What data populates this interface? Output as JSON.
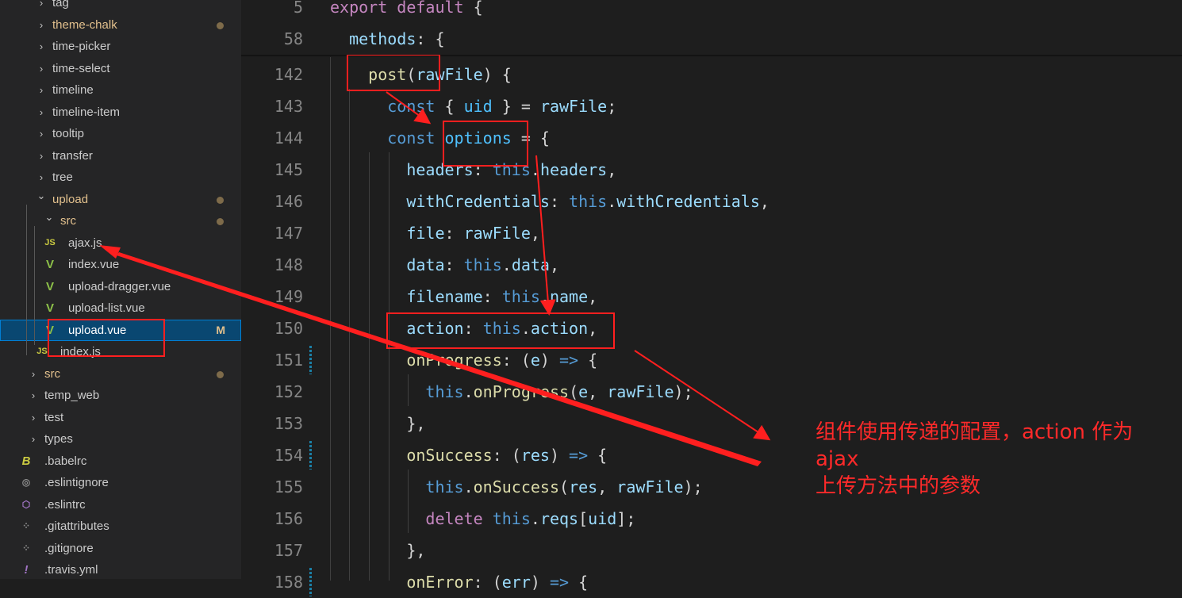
{
  "sidebar": {
    "rows": [
      {
        "label": "tag",
        "kind": "folder",
        "depth": 1
      },
      {
        "label": "theme-chalk",
        "kind": "folder",
        "depth": 1,
        "modified": true
      },
      {
        "label": "time-picker",
        "kind": "folder",
        "depth": 1
      },
      {
        "label": "time-select",
        "kind": "folder",
        "depth": 1
      },
      {
        "label": "timeline",
        "kind": "folder",
        "depth": 1
      },
      {
        "label": "timeline-item",
        "kind": "folder",
        "depth": 1
      },
      {
        "label": "tooltip",
        "kind": "folder",
        "depth": 1
      },
      {
        "label": "transfer",
        "kind": "folder",
        "depth": 1
      },
      {
        "label": "tree",
        "kind": "folder",
        "depth": 1
      },
      {
        "label": "upload",
        "kind": "folder-open",
        "depth": 1,
        "modified": true
      },
      {
        "label": "src",
        "kind": "folder-open",
        "depth": 2,
        "modified": true
      },
      {
        "label": "ajax.js",
        "kind": "js",
        "depth": 3
      },
      {
        "label": "index.vue",
        "kind": "vue",
        "depth": 3
      },
      {
        "label": "upload-dragger.vue",
        "kind": "vue",
        "depth": 3
      },
      {
        "label": "upload-list.vue",
        "kind": "vue",
        "depth": 3
      },
      {
        "label": "upload.vue",
        "kind": "vue",
        "depth": 3,
        "selected": true,
        "badge": "M"
      },
      {
        "label": "index.js",
        "kind": "js",
        "depth": 2
      },
      {
        "label": "src",
        "kind": "folder",
        "depth": 0,
        "modified": true
      },
      {
        "label": "temp_web",
        "kind": "folder",
        "depth": 0
      },
      {
        "label": "test",
        "kind": "folder",
        "depth": 0
      },
      {
        "label": "types",
        "kind": "folder",
        "depth": 0
      },
      {
        "label": ".babelrc",
        "kind": "babel",
        "depth": 0
      },
      {
        "label": ".eslintignore",
        "kind": "circle",
        "depth": 0
      },
      {
        "label": ".eslintrc",
        "kind": "eslint",
        "depth": 0
      },
      {
        "label": ".gitattributes",
        "kind": "git",
        "depth": 0
      },
      {
        "label": ".gitignore",
        "kind": "git",
        "depth": 0
      },
      {
        "label": ".travis.yml",
        "kind": "yml",
        "depth": 0
      }
    ],
    "icons": {
      "chevron_right": "›",
      "chevron_down": "⌄",
      "js": "JS",
      "vue": "V",
      "babel": "B",
      "circle": "◎",
      "eslint": "⬡",
      "git": "⁘",
      "yml": "!"
    }
  },
  "editor": {
    "lines": [
      {
        "num": "5",
        "sticky": true,
        "tokens": [
          [
            "kw2",
            "export "
          ],
          [
            "kw2",
            "default "
          ],
          [
            "pn",
            "{"
          ]
        ]
      },
      {
        "num": "58",
        "sticky": true,
        "tokens": [
          [
            "pn",
            "  "
          ],
          [
            "pr",
            "methods"
          ],
          [
            "pn",
            ": {"
          ]
        ]
      },
      {
        "num": "142",
        "tokens": [
          [
            "pn",
            "    "
          ],
          [
            "fn",
            "post"
          ],
          [
            "pn",
            "("
          ],
          [
            "vr",
            "rawFile"
          ],
          [
            "pn",
            ") {"
          ]
        ]
      },
      {
        "num": "143",
        "tokens": [
          [
            "pn",
            "      "
          ],
          [
            "kw",
            "const "
          ],
          [
            "pn",
            "{ "
          ],
          [
            "cn",
            "uid"
          ],
          [
            "pn",
            " } = "
          ],
          [
            "vr",
            "rawFile"
          ],
          [
            "pn",
            ";"
          ]
        ]
      },
      {
        "num": "144",
        "tokens": [
          [
            "pn",
            "      "
          ],
          [
            "kw",
            "const "
          ],
          [
            "cn",
            "options"
          ],
          [
            "pn",
            " = {"
          ]
        ]
      },
      {
        "num": "145",
        "tokens": [
          [
            "pn",
            "        "
          ],
          [
            "pr",
            "headers"
          ],
          [
            "pn",
            ": "
          ],
          [
            "kw",
            "this"
          ],
          [
            "pn",
            "."
          ],
          [
            "pr",
            "headers"
          ],
          [
            "pn",
            ","
          ]
        ]
      },
      {
        "num": "146",
        "tokens": [
          [
            "pn",
            "        "
          ],
          [
            "pr",
            "withCredentials"
          ],
          [
            "pn",
            ": "
          ],
          [
            "kw",
            "this"
          ],
          [
            "pn",
            "."
          ],
          [
            "pr",
            "withCredentials"
          ],
          [
            "pn",
            ","
          ]
        ]
      },
      {
        "num": "147",
        "tokens": [
          [
            "pn",
            "        "
          ],
          [
            "pr",
            "file"
          ],
          [
            "pn",
            ": "
          ],
          [
            "vr",
            "rawFile"
          ],
          [
            "pn",
            ","
          ]
        ]
      },
      {
        "num": "148",
        "tokens": [
          [
            "pn",
            "        "
          ],
          [
            "pr",
            "data"
          ],
          [
            "pn",
            ": "
          ],
          [
            "kw",
            "this"
          ],
          [
            "pn",
            "."
          ],
          [
            "pr",
            "data"
          ],
          [
            "pn",
            ","
          ]
        ]
      },
      {
        "num": "149",
        "tokens": [
          [
            "pn",
            "        "
          ],
          [
            "pr",
            "filename"
          ],
          [
            "pn",
            ": "
          ],
          [
            "kw",
            "this"
          ],
          [
            "pn",
            "."
          ],
          [
            "pr",
            "name"
          ],
          [
            "pn",
            ","
          ]
        ]
      },
      {
        "num": "150",
        "tokens": [
          [
            "pn",
            "        "
          ],
          [
            "pr",
            "action"
          ],
          [
            "pn",
            ": "
          ],
          [
            "kw",
            "this"
          ],
          [
            "pn",
            "."
          ],
          [
            "pr",
            "action"
          ],
          [
            "pn",
            ","
          ]
        ]
      },
      {
        "num": "151",
        "tokens": [
          [
            "pn",
            "        "
          ],
          [
            "fn",
            "onProgress"
          ],
          [
            "pn",
            ": ("
          ],
          [
            "vr",
            "e"
          ],
          [
            "pn",
            ") "
          ],
          [
            "kw",
            "=>"
          ],
          [
            "pn",
            " {"
          ]
        ],
        "git": true
      },
      {
        "num": "152",
        "tokens": [
          [
            "pn",
            "          "
          ],
          [
            "kw",
            "this"
          ],
          [
            "pn",
            "."
          ],
          [
            "fn",
            "onProgress"
          ],
          [
            "pn",
            "("
          ],
          [
            "vr",
            "e"
          ],
          [
            "pn",
            ", "
          ],
          [
            "vr",
            "rawFile"
          ],
          [
            "pn",
            ");"
          ]
        ]
      },
      {
        "num": "153",
        "tokens": [
          [
            "pn",
            "        },"
          ]
        ]
      },
      {
        "num": "154",
        "tokens": [
          [
            "pn",
            "        "
          ],
          [
            "fn",
            "onSuccess"
          ],
          [
            "pn",
            ": ("
          ],
          [
            "vr",
            "res"
          ],
          [
            "pn",
            ") "
          ],
          [
            "kw",
            "=>"
          ],
          [
            "pn",
            " {"
          ]
        ],
        "git": true
      },
      {
        "num": "155",
        "tokens": [
          [
            "pn",
            "          "
          ],
          [
            "kw",
            "this"
          ],
          [
            "pn",
            "."
          ],
          [
            "fn",
            "onSuccess"
          ],
          [
            "pn",
            "("
          ],
          [
            "vr",
            "res"
          ],
          [
            "pn",
            ", "
          ],
          [
            "vr",
            "rawFile"
          ],
          [
            "pn",
            ");"
          ]
        ]
      },
      {
        "num": "156",
        "tokens": [
          [
            "pn",
            "          "
          ],
          [
            "kw2",
            "delete "
          ],
          [
            "kw",
            "this"
          ],
          [
            "pn",
            "."
          ],
          [
            "pr",
            "reqs"
          ],
          [
            "pn",
            "["
          ],
          [
            "vr",
            "uid"
          ],
          [
            "pn",
            "];"
          ]
        ]
      },
      {
        "num": "157",
        "tokens": [
          [
            "pn",
            "        },"
          ]
        ]
      },
      {
        "num": "158",
        "tokens": [
          [
            "pn",
            "        "
          ],
          [
            "fn",
            "onError"
          ],
          [
            "pn",
            ": ("
          ],
          [
            "vr",
            "err"
          ],
          [
            "pn",
            ") "
          ],
          [
            "kw",
            "=>"
          ],
          [
            "pn",
            " {"
          ]
        ],
        "git": true
      }
    ]
  },
  "annotation": {
    "line1": "组件使用传递的配置，action 作为 ajax",
    "line2": "上传方法中的参数",
    "color": "#ff1f1f"
  }
}
